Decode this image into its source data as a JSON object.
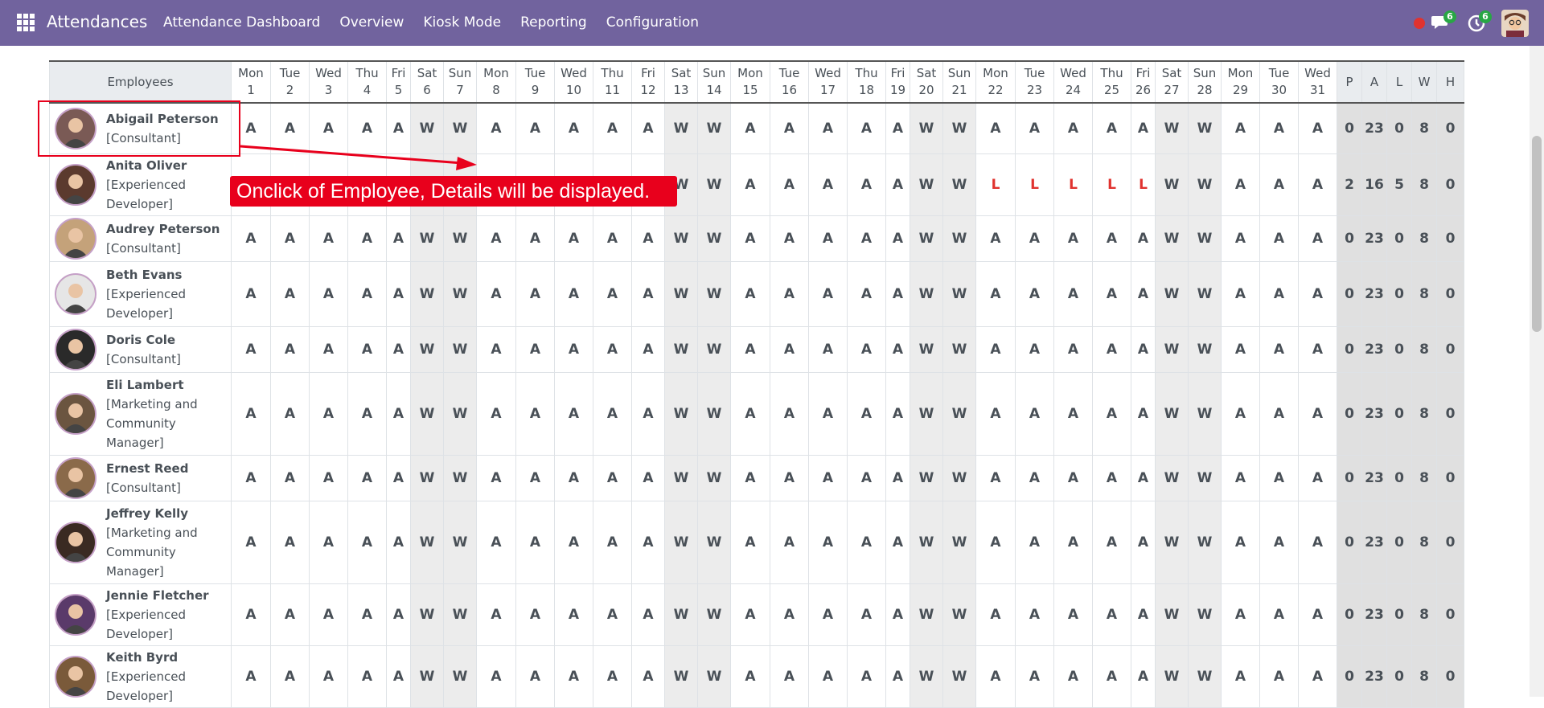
{
  "navbar": {
    "brand": "Attendances",
    "menu": [
      "Attendance Dashboard",
      "Overview",
      "Kiosk Mode",
      "Reporting",
      "Configuration"
    ],
    "messages_count": "6",
    "activities_count": "6"
  },
  "table": {
    "employees_header": "Employees",
    "days": [
      {
        "d": "Mon",
        "n": "1"
      },
      {
        "d": "Tue",
        "n": "2"
      },
      {
        "d": "Wed",
        "n": "3"
      },
      {
        "d": "Thu",
        "n": "4"
      },
      {
        "d": "Fri",
        "n": "5"
      },
      {
        "d": "Sat",
        "n": "6"
      },
      {
        "d": "Sun",
        "n": "7"
      },
      {
        "d": "Mon",
        "n": "8"
      },
      {
        "d": "Tue",
        "n": "9"
      },
      {
        "d": "Wed",
        "n": "10"
      },
      {
        "d": "Thu",
        "n": "11"
      },
      {
        "d": "Fri",
        "n": "12"
      },
      {
        "d": "Sat",
        "n": "13"
      },
      {
        "d": "Sun",
        "n": "14"
      },
      {
        "d": "Mon",
        "n": "15"
      },
      {
        "d": "Tue",
        "n": "16"
      },
      {
        "d": "Wed",
        "n": "17"
      },
      {
        "d": "Thu",
        "n": "18"
      },
      {
        "d": "Fri",
        "n": "19"
      },
      {
        "d": "Sat",
        "n": "20"
      },
      {
        "d": "Sun",
        "n": "21"
      },
      {
        "d": "Mon",
        "n": "22"
      },
      {
        "d": "Tue",
        "n": "23"
      },
      {
        "d": "Wed",
        "n": "24"
      },
      {
        "d": "Thu",
        "n": "25"
      },
      {
        "d": "Fri",
        "n": "26"
      },
      {
        "d": "Sat",
        "n": "27"
      },
      {
        "d": "Sun",
        "n": "28"
      },
      {
        "d": "Mon",
        "n": "29"
      },
      {
        "d": "Tue",
        "n": "30"
      },
      {
        "d": "Wed",
        "n": "31"
      }
    ],
    "summary_headers": [
      "P",
      "A",
      "L",
      "W",
      "H"
    ],
    "rows": [
      {
        "name": "Abigail Peterson",
        "role": [
          "[Consultant]"
        ],
        "cells": [
          "A",
          "A",
          "A",
          "A",
          "A",
          "W",
          "W",
          "A",
          "A",
          "A",
          "A",
          "A",
          "W",
          "W",
          "A",
          "A",
          "A",
          "A",
          "A",
          "W",
          "W",
          "A",
          "A",
          "A",
          "A",
          "A",
          "W",
          "W",
          "A",
          "A",
          "A"
        ],
        "summary": [
          "0",
          "23",
          "0",
          "8",
          "0"
        ]
      },
      {
        "name": "Anita Oliver",
        "role": [
          "[Experienced",
          "Developer]"
        ],
        "cells": [
          "",
          "",
          "",
          "",
          "",
          "",
          "",
          "",
          "",
          "",
          "",
          "",
          "W",
          "W",
          "A",
          "A",
          "A",
          "A",
          "A",
          "W",
          "W",
          "L",
          "L",
          "L",
          "L",
          "L",
          "W",
          "W",
          "A",
          "A",
          "A"
        ],
        "summary": [
          "2",
          "16",
          "5",
          "8",
          "0"
        ]
      },
      {
        "name": "Audrey Peterson",
        "role": [
          "[Consultant]"
        ],
        "cells": [
          "A",
          "A",
          "A",
          "A",
          "A",
          "W",
          "W",
          "A",
          "A",
          "A",
          "A",
          "A",
          "W",
          "W",
          "A",
          "A",
          "A",
          "A",
          "A",
          "W",
          "W",
          "A",
          "A",
          "A",
          "A",
          "A",
          "W",
          "W",
          "A",
          "A",
          "A"
        ],
        "summary": [
          "0",
          "23",
          "0",
          "8",
          "0"
        ]
      },
      {
        "name": "Beth Evans",
        "role": [
          "[Experienced",
          "Developer]"
        ],
        "cells": [
          "A",
          "A",
          "A",
          "A",
          "A",
          "W",
          "W",
          "A",
          "A",
          "A",
          "A",
          "A",
          "W",
          "W",
          "A",
          "A",
          "A",
          "A",
          "A",
          "W",
          "W",
          "A",
          "A",
          "A",
          "A",
          "A",
          "W",
          "W",
          "A",
          "A",
          "A"
        ],
        "summary": [
          "0",
          "23",
          "0",
          "8",
          "0"
        ]
      },
      {
        "name": "Doris Cole",
        "role": [
          "[Consultant]"
        ],
        "cells": [
          "A",
          "A",
          "A",
          "A",
          "A",
          "W",
          "W",
          "A",
          "A",
          "A",
          "A",
          "A",
          "W",
          "W",
          "A",
          "A",
          "A",
          "A",
          "A",
          "W",
          "W",
          "A",
          "A",
          "A",
          "A",
          "A",
          "W",
          "W",
          "A",
          "A",
          "A"
        ],
        "summary": [
          "0",
          "23",
          "0",
          "8",
          "0"
        ]
      },
      {
        "name": "Eli Lambert",
        "role": [
          "[Marketing and",
          "Community",
          "Manager]"
        ],
        "cells": [
          "A",
          "A",
          "A",
          "A",
          "A",
          "W",
          "W",
          "A",
          "A",
          "A",
          "A",
          "A",
          "W",
          "W",
          "A",
          "A",
          "A",
          "A",
          "A",
          "W",
          "W",
          "A",
          "A",
          "A",
          "A",
          "A",
          "W",
          "W",
          "A",
          "A",
          "A"
        ],
        "summary": [
          "0",
          "23",
          "0",
          "8",
          "0"
        ]
      },
      {
        "name": "Ernest Reed",
        "role": [
          "[Consultant]"
        ],
        "cells": [
          "A",
          "A",
          "A",
          "A",
          "A",
          "W",
          "W",
          "A",
          "A",
          "A",
          "A",
          "A",
          "W",
          "W",
          "A",
          "A",
          "A",
          "A",
          "A",
          "W",
          "W",
          "A",
          "A",
          "A",
          "A",
          "A",
          "W",
          "W",
          "A",
          "A",
          "A"
        ],
        "summary": [
          "0",
          "23",
          "0",
          "8",
          "0"
        ]
      },
      {
        "name": "Jeffrey Kelly",
        "role": [
          "[Marketing and",
          "Community",
          "Manager]"
        ],
        "cells": [
          "A",
          "A",
          "A",
          "A",
          "A",
          "W",
          "W",
          "A",
          "A",
          "A",
          "A",
          "A",
          "W",
          "W",
          "A",
          "A",
          "A",
          "A",
          "A",
          "W",
          "W",
          "A",
          "A",
          "A",
          "A",
          "A",
          "W",
          "W",
          "A",
          "A",
          "A"
        ],
        "summary": [
          "0",
          "23",
          "0",
          "8",
          "0"
        ]
      },
      {
        "name": "Jennie Fletcher",
        "role": [
          "[Experienced",
          "Developer]"
        ],
        "cells": [
          "A",
          "A",
          "A",
          "A",
          "A",
          "W",
          "W",
          "A",
          "A",
          "A",
          "A",
          "A",
          "W",
          "W",
          "A",
          "A",
          "A",
          "A",
          "A",
          "W",
          "W",
          "A",
          "A",
          "A",
          "A",
          "A",
          "W",
          "W",
          "A",
          "A",
          "A"
        ],
        "summary": [
          "0",
          "23",
          "0",
          "8",
          "0"
        ]
      },
      {
        "name": "Keith Byrd",
        "role": [
          "[Experienced",
          "Developer]"
        ],
        "cells": [
          "A",
          "A",
          "A",
          "A",
          "A",
          "W",
          "W",
          "A",
          "A",
          "A",
          "A",
          "A",
          "W",
          "W",
          "A",
          "A",
          "A",
          "A",
          "A",
          "W",
          "W",
          "A",
          "A",
          "A",
          "A",
          "A",
          "W",
          "W",
          "A",
          "A",
          "A"
        ],
        "summary": [
          "0",
          "23",
          "0",
          "8",
          "0"
        ]
      }
    ]
  },
  "annotation": {
    "text": "Onclick of Employee, Details will be displayed."
  }
}
